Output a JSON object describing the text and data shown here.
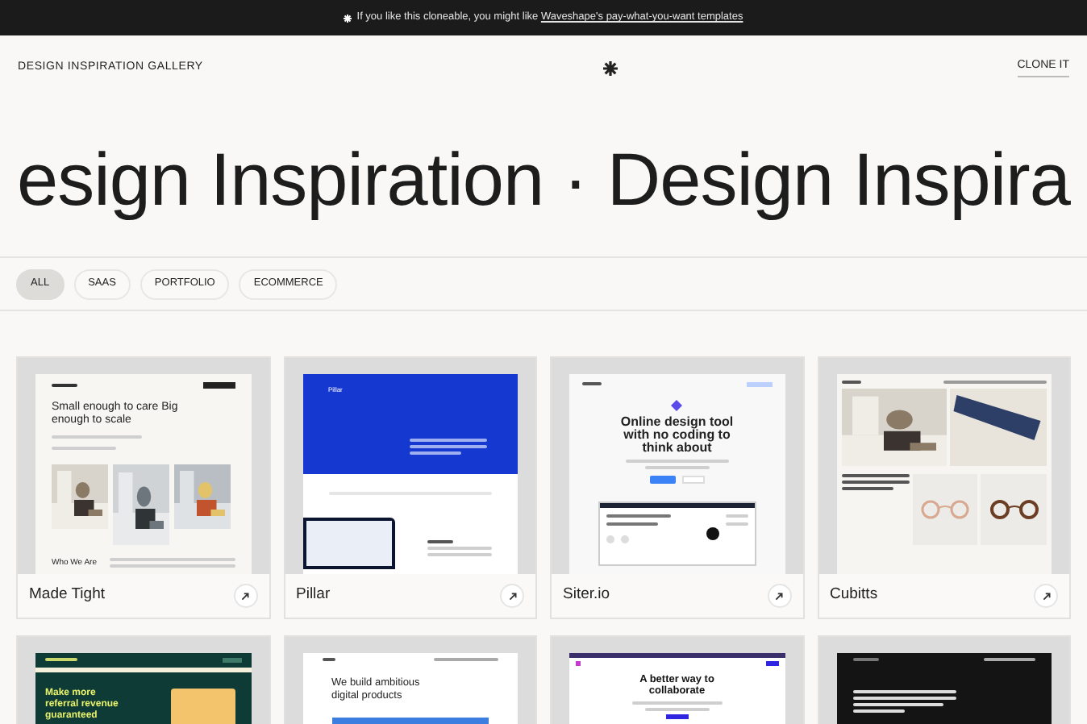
{
  "banner": {
    "text": "If you like this cloneable, you might like ",
    "link": "Waveshape's pay-what-you-want templates"
  },
  "header": {
    "title": "DESIGN INSPIRATION GALLERY",
    "action": "CLONE IT"
  },
  "marquee": "esign Inspiration · Design Inspira",
  "filters": [
    {
      "label": "ALL",
      "selected": true
    },
    {
      "label": "SAAS",
      "selected": false
    },
    {
      "label": "PORTFOLIO",
      "selected": false
    },
    {
      "label": "ECOMMERCE",
      "selected": false
    }
  ],
  "cards": [
    {
      "name": "Made Tight",
      "preview": {
        "kind": "light",
        "headline": "Small enough to care Big enough to scale",
        "subheading": "Who We Are"
      }
    },
    {
      "name": "Pillar",
      "preview": {
        "kind": "blue",
        "headline": "Pillar"
      }
    },
    {
      "name": "Siter.io",
      "preview": {
        "kind": "tool",
        "headline": "Online design tool with no coding to think about"
      }
    },
    {
      "name": "Cubitts",
      "preview": {
        "kind": "shop"
      }
    },
    {
      "preview": {
        "kind": "green",
        "headline": "Make more referral revenue guaranteed"
      }
    },
    {
      "preview": {
        "kind": "plain",
        "headline": "We build ambitious digital products"
      }
    },
    {
      "preview": {
        "kind": "collab",
        "headline": "A better way to collaborate"
      }
    },
    {
      "preview": {
        "kind": "dark"
      }
    }
  ]
}
